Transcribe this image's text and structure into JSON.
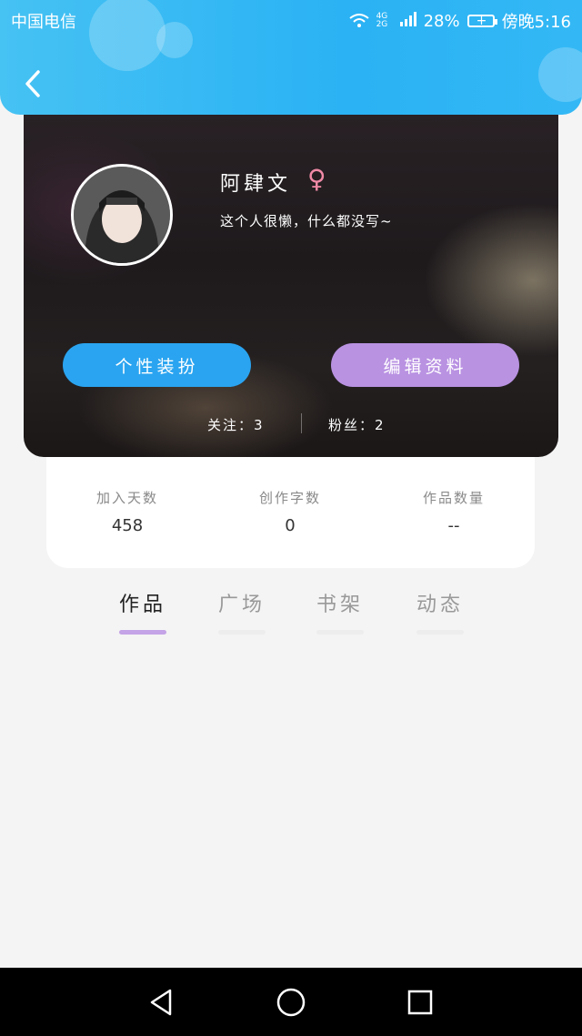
{
  "status_bar": {
    "carrier": "中国电信",
    "network": "4G 2G",
    "battery_percent": "28%",
    "time": "傍晚5:16"
  },
  "profile": {
    "username": "阿肆文",
    "gender_symbol": "♀",
    "bio": "这个人很懒，什么都没写~",
    "buttons": {
      "dress_up": "个性装扮",
      "edit_profile": "编辑资料"
    },
    "follow_label": "关注：3",
    "fans_label": "粉丝：2"
  },
  "stats": [
    {
      "label": "加入天数",
      "value": "458"
    },
    {
      "label": "创作字数",
      "value": "0"
    },
    {
      "label": "作品数量",
      "value": "--"
    }
  ],
  "tabs": [
    {
      "label": "作品",
      "active": true
    },
    {
      "label": "广场",
      "active": false
    },
    {
      "label": "书架",
      "active": false
    },
    {
      "label": "动态",
      "active": false
    }
  ],
  "colors": {
    "header_blue": "#2ab2f4",
    "dress_button": "#2aa4f0",
    "edit_button": "#b992e2",
    "gender_pink": "#f08aa6",
    "active_tab_line": "#c4a3e6"
  },
  "icons": {
    "back": "chevron-left-icon",
    "nav_back": "triangle-back-icon",
    "nav_home": "circle-home-icon",
    "nav_recents": "square-recents-icon"
  }
}
